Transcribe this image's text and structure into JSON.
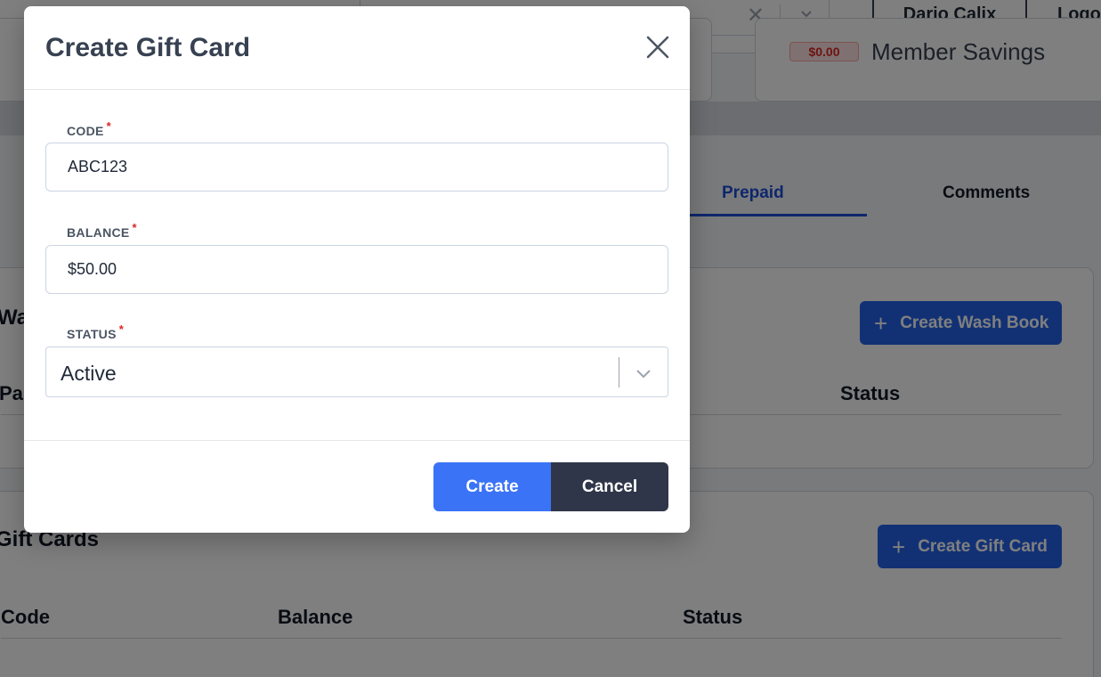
{
  "header": {
    "user_label": "Dario Calix",
    "logout_label": "Logout"
  },
  "summary": {
    "savings_badge": "$0.00",
    "savings_label": "Member Savings"
  },
  "tabs": {
    "prepaid": "Prepaid",
    "comments": "Comments"
  },
  "wash_books": {
    "title": "Wash Books",
    "create_label": "Create Wash Book",
    "columns": [
      "Pass",
      "Status"
    ]
  },
  "gift_cards": {
    "title": "Gift Cards",
    "create_label": "Create Gift Card",
    "columns": [
      "Code",
      "Balance",
      "Status"
    ]
  },
  "modal": {
    "title": "Create Gift Card",
    "code_label": "CODE",
    "code_value": "ABC123",
    "balance_label": "BALANCE",
    "balance_value": "$50.00",
    "status_label": "STATUS",
    "status_value": "Active",
    "required_mark": "*",
    "create_label": "Create",
    "cancel_label": "Cancel"
  },
  "colors": {
    "primary": "#3b73f7",
    "dark": "#303649",
    "required": "#dc2626",
    "tab_active": "#1d4ed8"
  }
}
